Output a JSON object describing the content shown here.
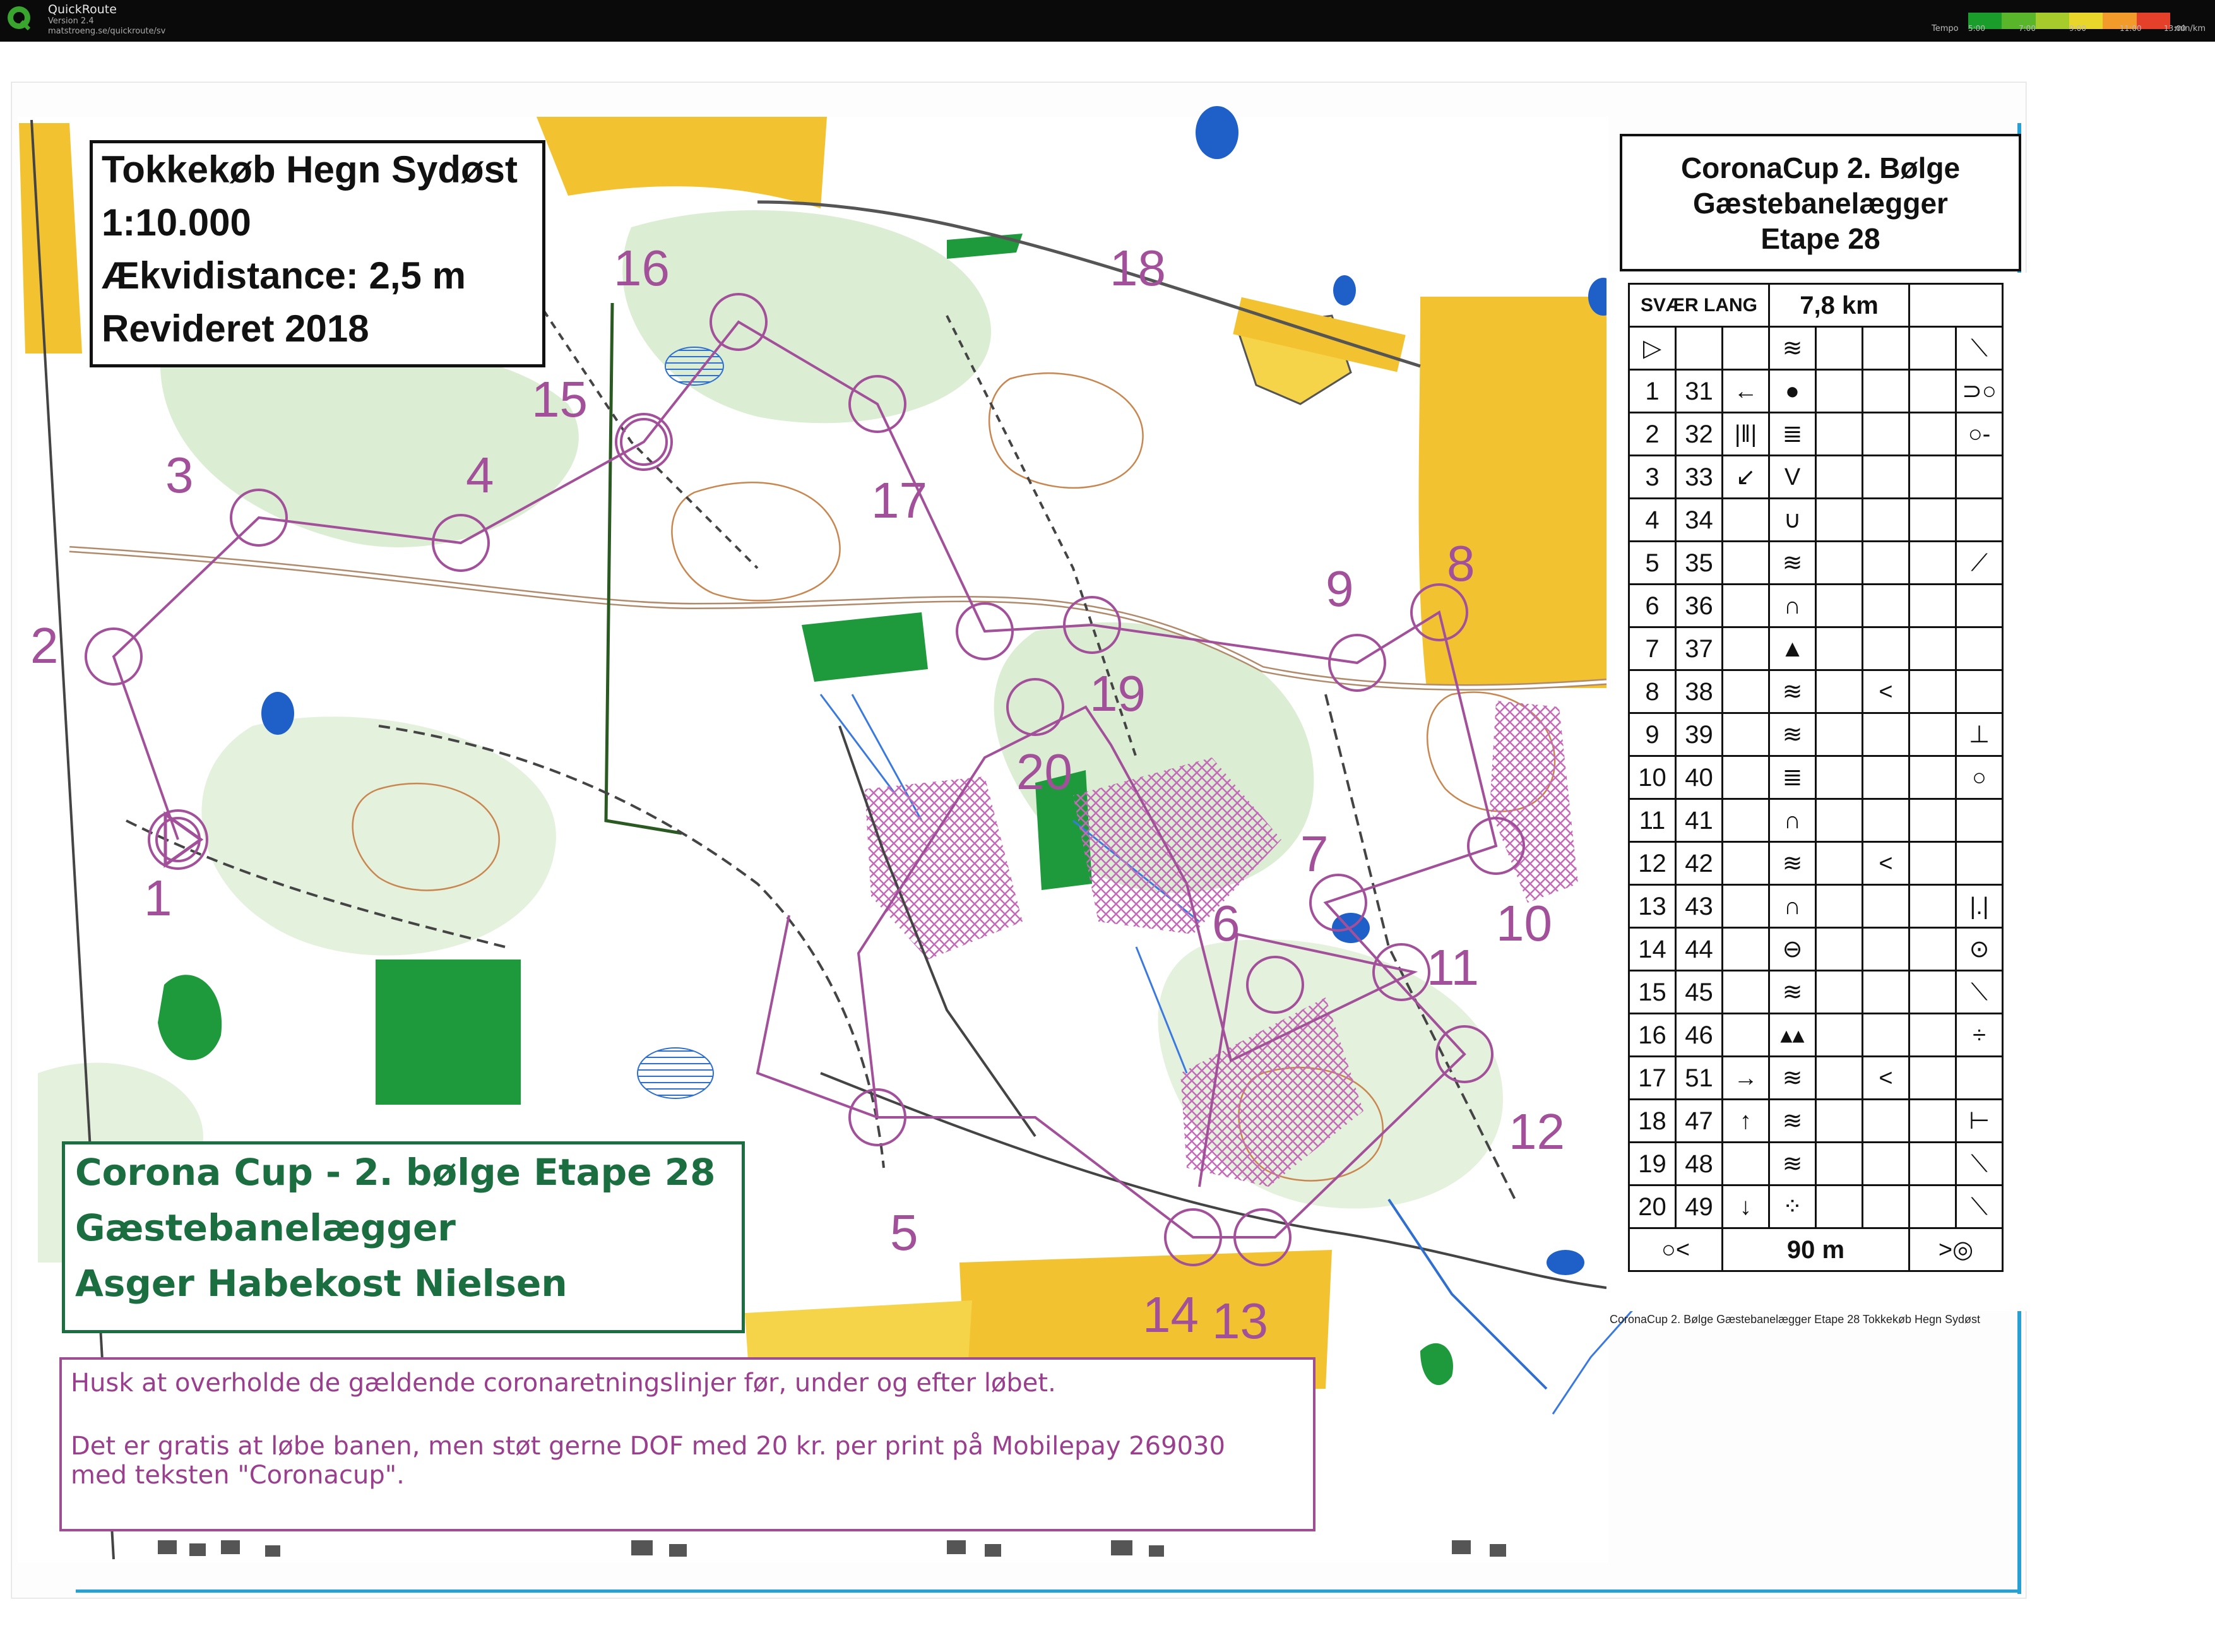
{
  "app": {
    "name": "QuickRoute",
    "version": "Version 2.4",
    "url": "matstroeng.se/quickroute/sv",
    "legend_label": "Tempo",
    "legend_unit": "min/km",
    "legend_ticks": [
      "5:00",
      "7:00",
      "9:00",
      "11:00",
      "13:00"
    ],
    "legend_colors": [
      "#1a9d2a",
      "#59b52a",
      "#a6cc2c",
      "#e8d62a",
      "#f29a2a",
      "#e5402a"
    ]
  },
  "map": {
    "title_lines": [
      "Tokkekøb Hegn Sydøst",
      "1:10.000",
      "Ækvidistance: 2,5 m",
      "Revideret 2018"
    ],
    "event_lines": [
      "Corona Cup - 2. bølge Etape 28",
      "Gæstebanelægger",
      "Asger Habekost Nielsen"
    ],
    "notice_lines": [
      "Husk at overholde de gældende coronaretningslinjer før, under og efter løbet.",
      "",
      "Det er gratis at løbe banen, men støt gerne DOF med 20 kr. per print på Mobilepay 269030",
      "med teksten \"Coronacup\"."
    ],
    "cc_lines": [
      "CoronaCup 2. Bølge",
      "Gæstebanelægger",
      "Etape 28"
    ],
    "control_numbers": [
      "1",
      "2",
      "3",
      "4",
      "5",
      "6",
      "7",
      "8",
      "9",
      "10",
      "11",
      "12",
      "13",
      "14",
      "15",
      "16",
      "17",
      "18",
      "19",
      "20"
    ],
    "colors": {
      "course": "#a3509a",
      "open_land": "#f2c230",
      "green": "#1e9a3c",
      "light_green": "#cfe8c4",
      "water": "#2f6fd0",
      "contour": "#c9864f",
      "forbidden": "#c46ab8"
    }
  },
  "description": {
    "header_class": "SVÆR LANG",
    "header_length": "7,8 km",
    "finish_distance": "90 m",
    "footer": "CoronaCup 2. Bølge Gæstebanelægger Etape 28 Tokkekøb Hegn Sydøst",
    "rows": [
      {
        "seq": "1",
        "code": "31",
        "c": "←",
        "d": "●",
        "e": "",
        "f": "",
        "g": "",
        "h": "⊃○"
      },
      {
        "seq": "2",
        "code": "32",
        "c": "|‖|",
        "d": "≣",
        "e": "",
        "f": "",
        "g": "",
        "h": "○-"
      },
      {
        "seq": "3",
        "code": "33",
        "c": "↙",
        "d": "V",
        "e": "",
        "f": "",
        "g": "",
        "h": ""
      },
      {
        "seq": "4",
        "code": "34",
        "c": "",
        "d": "∪",
        "e": "",
        "f": "",
        "g": "",
        "h": ""
      },
      {
        "seq": "5",
        "code": "35",
        "c": "",
        "d": "≋",
        "e": "",
        "f": "",
        "g": "",
        "h": "⟋"
      },
      {
        "seq": "6",
        "code": "36",
        "c": "",
        "d": "∩",
        "e": "",
        "f": "",
        "g": "",
        "h": ""
      },
      {
        "seq": "7",
        "code": "37",
        "c": "",
        "d": "▲",
        "e": "",
        "f": "",
        "g": "",
        "h": ""
      },
      {
        "seq": "8",
        "code": "38",
        "c": "",
        "d": "≋",
        "e": "",
        "f": "<",
        "g": "",
        "h": ""
      },
      {
        "seq": "9",
        "code": "39",
        "c": "",
        "d": "≋",
        "e": "",
        "f": "",
        "g": "",
        "h": "⊥"
      },
      {
        "seq": "10",
        "code": "40",
        "c": "",
        "d": "≣",
        "e": "",
        "f": "",
        "g": "",
        "h": "○"
      },
      {
        "seq": "11",
        "code": "41",
        "c": "",
        "d": "∩",
        "e": "",
        "f": "",
        "g": "",
        "h": ""
      },
      {
        "seq": "12",
        "code": "42",
        "c": "",
        "d": "≋",
        "e": "",
        "f": "<",
        "g": "",
        "h": ""
      },
      {
        "seq": "13",
        "code": "43",
        "c": "",
        "d": "∩",
        "e": "",
        "f": "",
        "g": "",
        "h": "|.|"
      },
      {
        "seq": "14",
        "code": "44",
        "c": "",
        "d": "⊖",
        "e": "",
        "f": "",
        "g": "",
        "h": "⊙"
      },
      {
        "seq": "15",
        "code": "45",
        "c": "",
        "d": "≋",
        "e": "",
        "f": "",
        "g": "",
        "h": "⟍"
      },
      {
        "seq": "16",
        "code": "46",
        "c": "",
        "d": "▴▴",
        "e": "",
        "f": "",
        "g": "",
        "h": "÷"
      },
      {
        "seq": "17",
        "code": "51",
        "c": "→",
        "d": "≋",
        "e": "",
        "f": "<",
        "g": "",
        "h": ""
      },
      {
        "seq": "18",
        "code": "47",
        "c": "↑",
        "d": "≋",
        "e": "",
        "f": "",
        "g": "",
        "h": "⊢"
      },
      {
        "seq": "19",
        "code": "48",
        "c": "",
        "d": "≋",
        "e": "",
        "f": "",
        "g": "",
        "h": "⟍"
      },
      {
        "seq": "20",
        "code": "49",
        "c": "↓",
        "d": "⁘",
        "e": "",
        "f": "",
        "g": "",
        "h": "⟍"
      }
    ]
  }
}
